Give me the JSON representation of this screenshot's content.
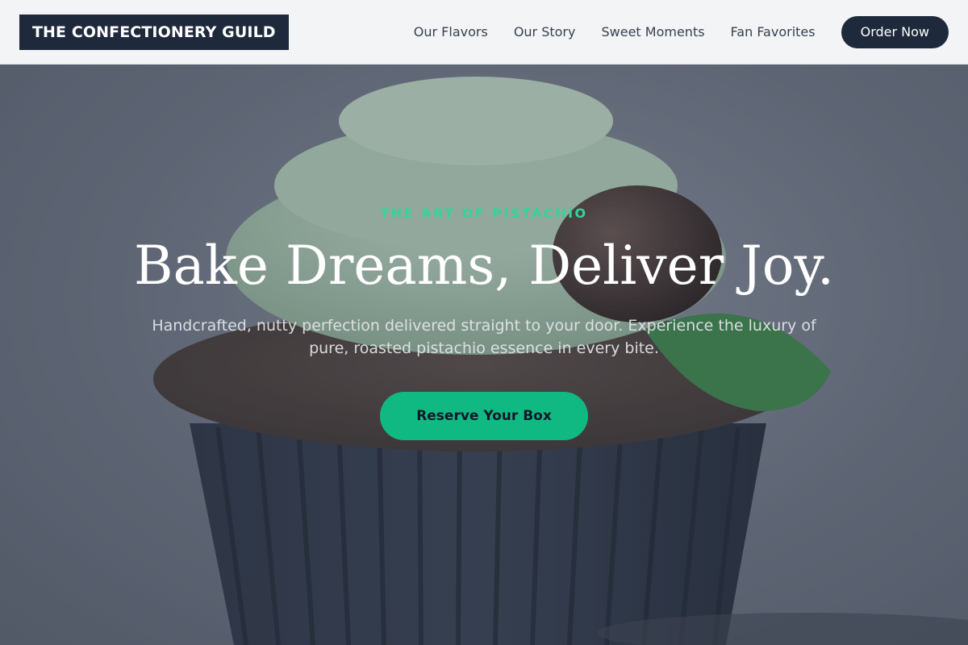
{
  "header": {
    "logo_text": "THE CONFECTIONERY GUILD",
    "nav": [
      {
        "label": "Our Flavors"
      },
      {
        "label": "Our Story"
      },
      {
        "label": "Sweet Moments"
      },
      {
        "label": "Fan Favorites"
      }
    ],
    "order_button": "Order Now"
  },
  "hero": {
    "eyebrow": "THE ART OF PISTACHIO",
    "headline": "Bake Dreams, Deliver Joy.",
    "subtext": "Handcrafted, nutty perfection delivered straight to your door. Experience the luxury of pure, roasted pistachio essence in every bite.",
    "cta": "Reserve Your Box",
    "background_image": "cupcake-photo"
  },
  "colors": {
    "brand_dark": "#1e293b",
    "accent_green": "#10b981",
    "eyebrow_green": "#34d399",
    "header_bg": "#f3f4f6"
  }
}
